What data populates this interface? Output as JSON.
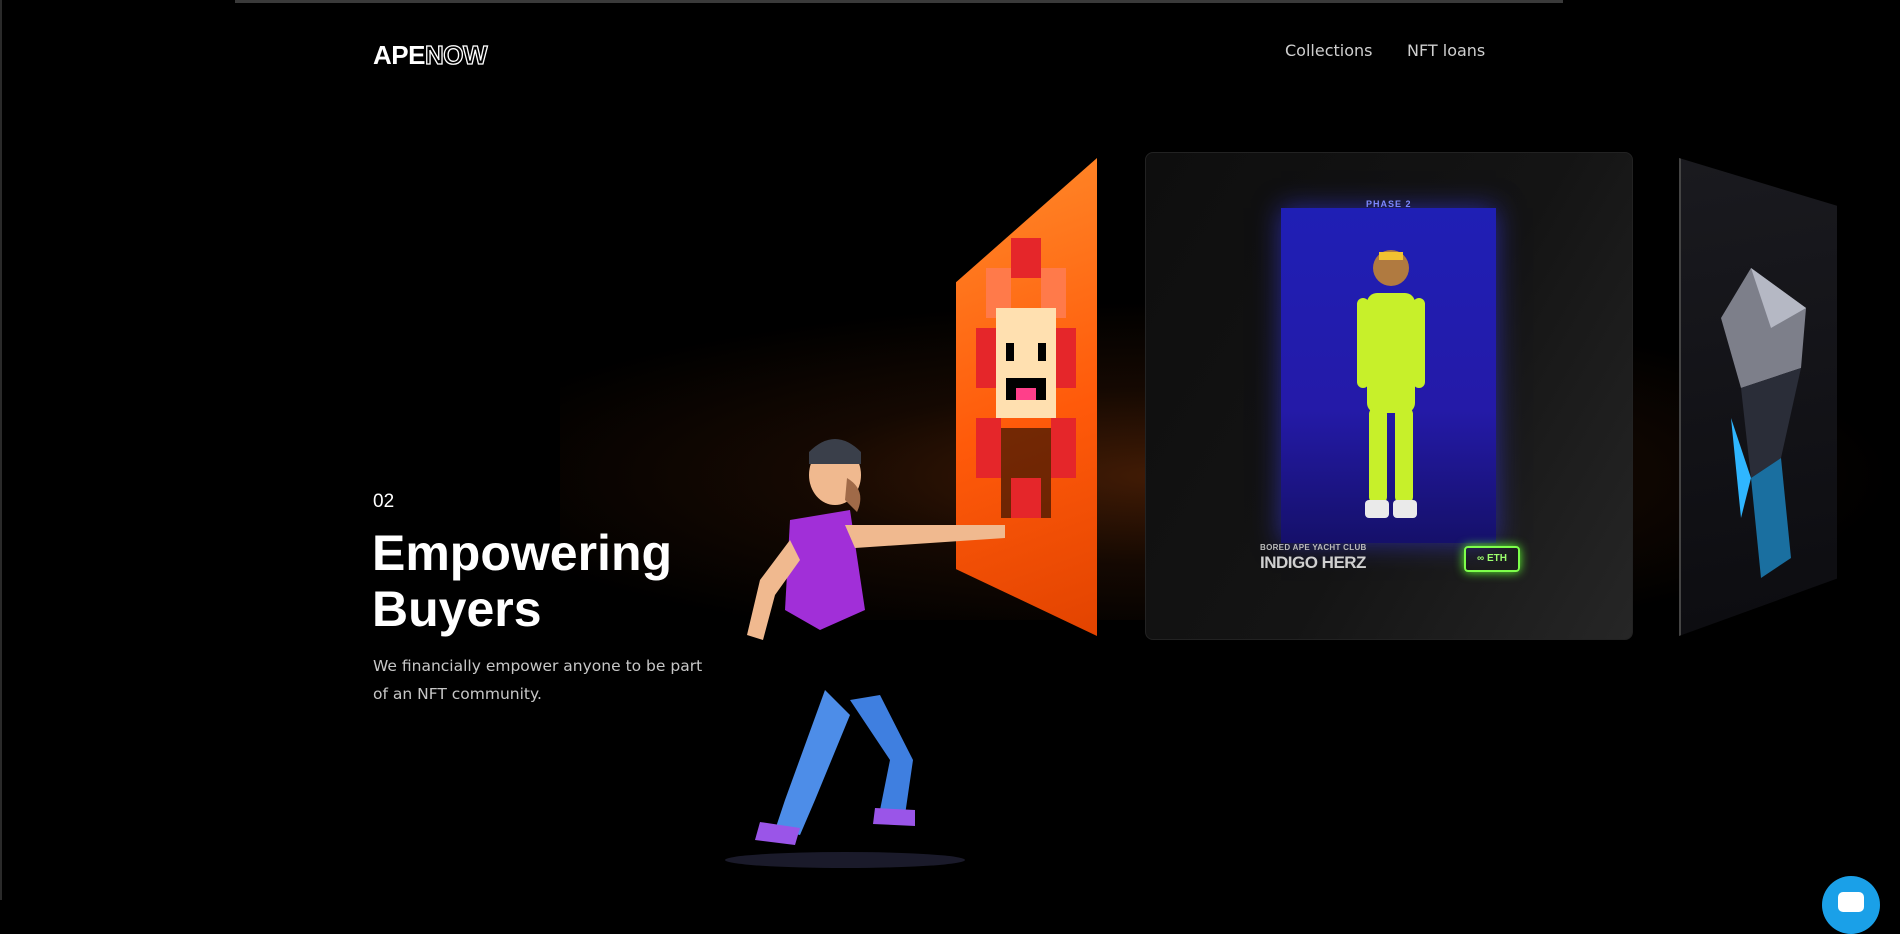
{
  "header": {
    "logo_primary": "APE",
    "logo_secondary": "NOW",
    "nav": [
      {
        "label": "Collections"
      },
      {
        "label": "NFT loans"
      }
    ]
  },
  "hero": {
    "step": "02",
    "title_line1": "Empowering",
    "title_line2": "Buyers",
    "description": "We financially empower anyone to be part of an NFT community."
  },
  "cards": {
    "center": {
      "phase_label": "PHASE 2",
      "collection": "BORED APE YACHT CLUB",
      "name": "INDIGO HERZ",
      "badge": "∞ ETH"
    }
  },
  "colors": {
    "background": "#000000",
    "orange_card": "#ff5a0a",
    "ape_frame": "#241aa8",
    "badge_green": "#7dff4b",
    "chat_button": "#1aa0e8"
  },
  "icons": {
    "chat": "chat-bubble-icon"
  }
}
